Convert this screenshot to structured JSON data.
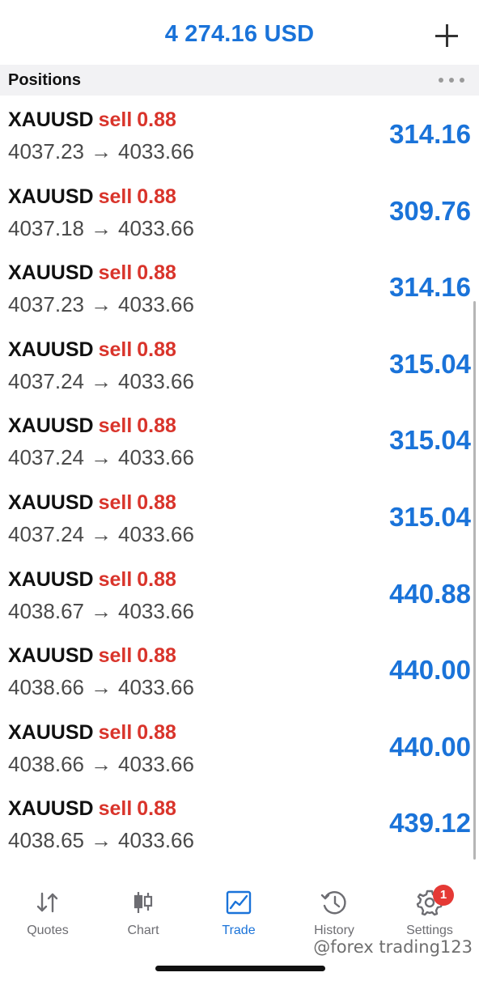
{
  "header": {
    "balance": "4 274.16 USD"
  },
  "section": {
    "title": "Positions"
  },
  "positions": [
    {
      "symbol": "XAUUSD",
      "side": "sell",
      "lots": "0.88",
      "open": "4037.23",
      "arrow": "→",
      "current": "4033.66",
      "profit": "314.16"
    },
    {
      "symbol": "XAUUSD",
      "side": "sell",
      "lots": "0.88",
      "open": "4037.18",
      "arrow": "→",
      "current": "4033.66",
      "profit": "309.76"
    },
    {
      "symbol": "XAUUSD",
      "side": "sell",
      "lots": "0.88",
      "open": "4037.23",
      "arrow": "→",
      "current": "4033.66",
      "profit": "314.16"
    },
    {
      "symbol": "XAUUSD",
      "side": "sell",
      "lots": "0.88",
      "open": "4037.24",
      "arrow": "→",
      "current": "4033.66",
      "profit": "315.04"
    },
    {
      "symbol": "XAUUSD",
      "side": "sell",
      "lots": "0.88",
      "open": "4037.24",
      "arrow": "→",
      "current": "4033.66",
      "profit": "315.04"
    },
    {
      "symbol": "XAUUSD",
      "side": "sell",
      "lots": "0.88",
      "open": "4037.24",
      "arrow": "→",
      "current": "4033.66",
      "profit": "315.04"
    },
    {
      "symbol": "XAUUSD",
      "side": "sell",
      "lots": "0.88",
      "open": "4038.67",
      "arrow": "→",
      "current": "4033.66",
      "profit": "440.88"
    },
    {
      "symbol": "XAUUSD",
      "side": "sell",
      "lots": "0.88",
      "open": "4038.66",
      "arrow": "→",
      "current": "4033.66",
      "profit": "440.00"
    },
    {
      "symbol": "XAUUSD",
      "side": "sell",
      "lots": "0.88",
      "open": "4038.66",
      "arrow": "→",
      "current": "4033.66",
      "profit": "440.00"
    },
    {
      "symbol": "XAUUSD",
      "side": "sell",
      "lots": "0.88",
      "open": "4038.65",
      "arrow": "→",
      "current": "4033.66",
      "profit": "439.12"
    }
  ],
  "tabs": [
    {
      "label": "Quotes",
      "icon": "quotes-arrows-icon",
      "active": false
    },
    {
      "label": "Chart",
      "icon": "candlestick-icon",
      "active": false
    },
    {
      "label": "Trade",
      "icon": "trade-chart-icon",
      "active": true
    },
    {
      "label": "History",
      "icon": "history-clock-icon",
      "active": false
    },
    {
      "label": "Settings",
      "icon": "gear-icon",
      "active": false,
      "badge": "1"
    }
  ],
  "watermark": "@forex trading123",
  "colors": {
    "accent": "#1a73d9",
    "sell": "#d9342b",
    "badge": "#e53935"
  }
}
